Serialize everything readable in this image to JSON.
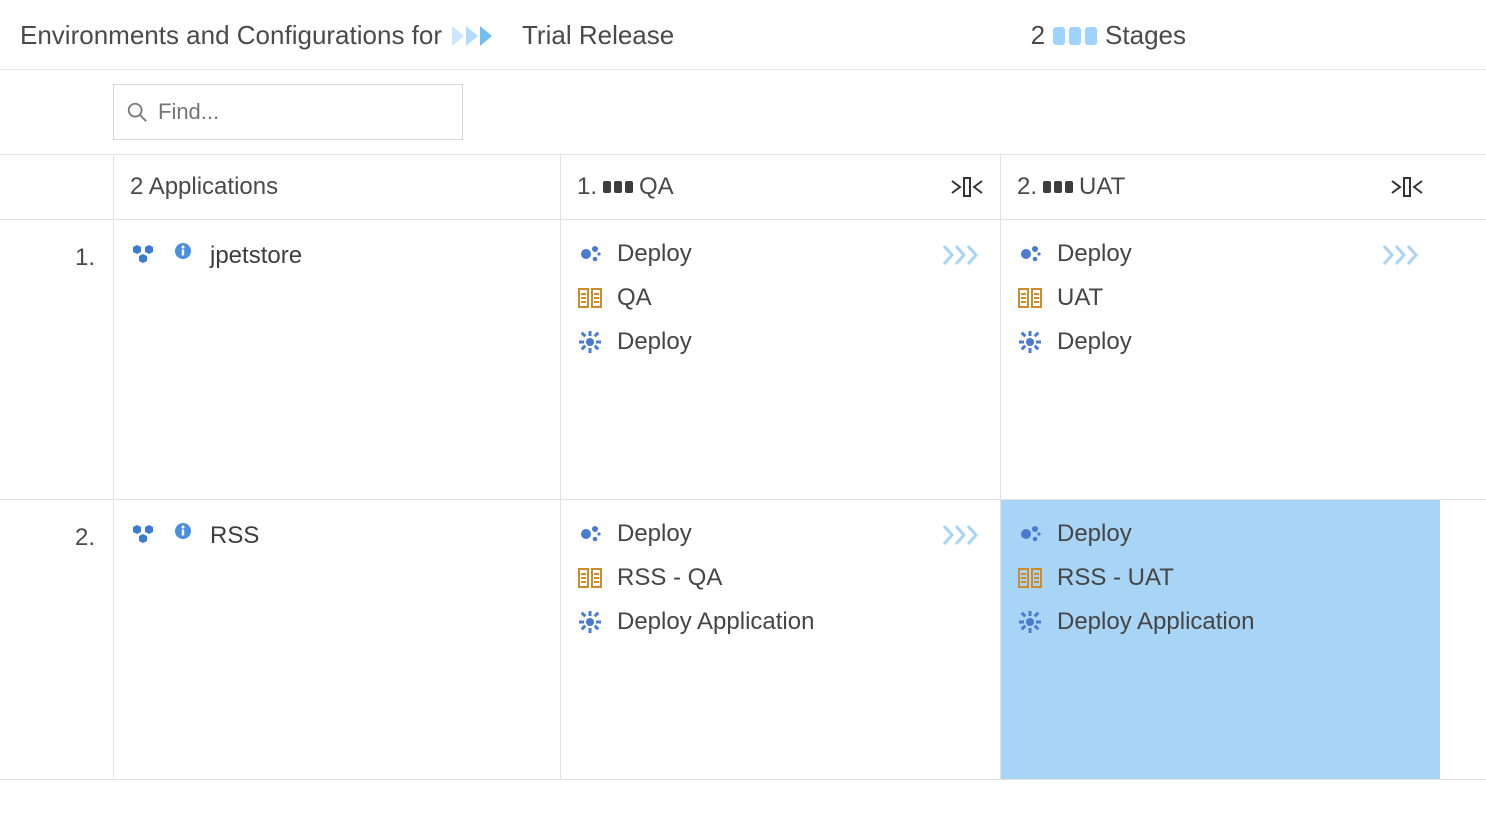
{
  "header": {
    "title_prefix": "Environments and Configurations for",
    "release_name": "Trial Release",
    "stage_count": "2",
    "stage_label": "Stages"
  },
  "search": {
    "placeholder": "Find..."
  },
  "columns": {
    "apps_header": "2 Applications",
    "stages": [
      {
        "num": "1.",
        "name": "QA"
      },
      {
        "num": "2.",
        "name": "UAT"
      }
    ]
  },
  "rows": [
    {
      "num": "1.",
      "app": "jpetstore",
      "cells": [
        {
          "deploy": "Deploy",
          "env": "QA",
          "process": "Deploy",
          "selected": false,
          "chev": true
        },
        {
          "deploy": "Deploy",
          "env": "UAT",
          "process": "Deploy",
          "selected": false,
          "chev": true
        }
      ]
    },
    {
      "num": "2.",
      "app": "RSS",
      "cells": [
        {
          "deploy": "Deploy",
          "env": "RSS - QA",
          "process": "Deploy Application",
          "selected": false,
          "chev": true
        },
        {
          "deploy": "Deploy",
          "env": "RSS - UAT",
          "process": "Deploy Application",
          "selected": true,
          "chev": false
        }
      ]
    }
  ]
}
